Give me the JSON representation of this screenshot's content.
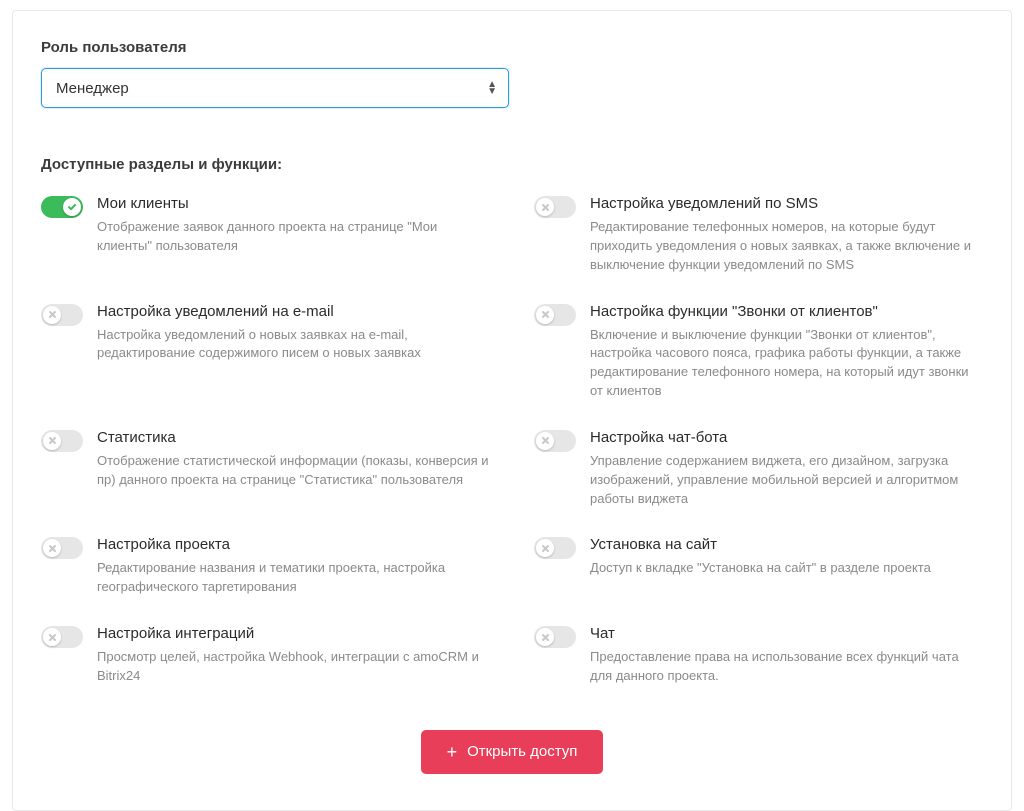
{
  "role": {
    "label": "Роль пользователя",
    "selected": "Менеджер"
  },
  "section_title": "Доступные разделы и функции:",
  "features": [
    {
      "on": true,
      "title": "Мои клиенты",
      "desc": "Отображение заявок данного проекта на странице \"Мои клиенты\" пользователя"
    },
    {
      "on": false,
      "title": "Настройка уведомлений по SMS",
      "desc": "Редактирование телефонных номеров, на которые будут приходить уведомления о новых заявках, а также включение и выключение функции уведомлений по SMS"
    },
    {
      "on": false,
      "title": "Настройка уведомлений на e-mail",
      "desc": "Настройка уведомлений о новых заявках на e-mail, редактирование содержимого писем о новых заявках"
    },
    {
      "on": false,
      "title": "Настройка функции \"Звонки от клиентов\"",
      "desc": "Включение и выключение функции \"Звонки от клиентов\", настройка часового пояса, графика работы функции, а также редактирование телефонного номера, на который идут звонки от клиентов"
    },
    {
      "on": false,
      "title": "Статистика",
      "desc": "Отображение статистической информации (показы, конверсия и пр) данного проекта на странице \"Статистика\" пользователя"
    },
    {
      "on": false,
      "title": "Настройка чат-бота",
      "desc": "Управление содержанием виджета, его дизайном, загрузка изображений, управление мобильной версией и алгоритмом работы виджета"
    },
    {
      "on": false,
      "title": "Настройка проекта",
      "desc": "Редактирование названия и тематики проекта, настройка географического таргетирования"
    },
    {
      "on": false,
      "title": "Установка на сайт",
      "desc": "Доступ к вкладке \"Установка на сайт\" в разделе проекта"
    },
    {
      "on": false,
      "title": "Настройка интеграций",
      "desc": "Просмотр целей, настройка Webhook, интеграции с amoCRM и Bitrix24"
    },
    {
      "on": false,
      "title": "Чат",
      "desc": "Предоставление права на использование всех функций чата для данного проекта."
    }
  ],
  "button": {
    "label": "Открыть доступ",
    "plus": "+"
  }
}
